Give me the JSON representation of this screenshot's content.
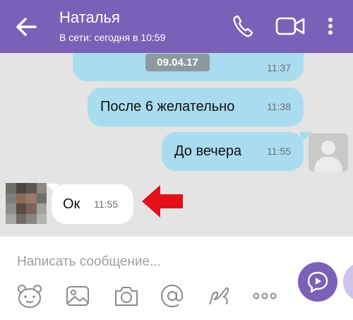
{
  "header": {
    "contact_name": "Наталья",
    "status": "В сети: сегодня в 10:59",
    "color": "#7b60b8"
  },
  "chat": {
    "date_label": "09.04.17",
    "messages": [
      {
        "text": "",
        "time": "11:37",
        "direction": "outgoing"
      },
      {
        "text": "После 6 желательно",
        "time": "11:38",
        "direction": "outgoing"
      },
      {
        "text": "До вечера",
        "time": "11:55",
        "direction": "outgoing"
      },
      {
        "text": "Ок",
        "time": "11:55",
        "direction": "incoming"
      }
    ],
    "outgoing_bubble_color": "#a9dcef",
    "incoming_bubble_color": "#ffffff",
    "annotation": "red-arrow"
  },
  "composer": {
    "placeholder": "Написать сообщение...",
    "tools": [
      "sticker-icon",
      "gallery-icon",
      "camera-icon",
      "at-icon",
      "doodle-icon",
      "more-icon"
    ]
  }
}
